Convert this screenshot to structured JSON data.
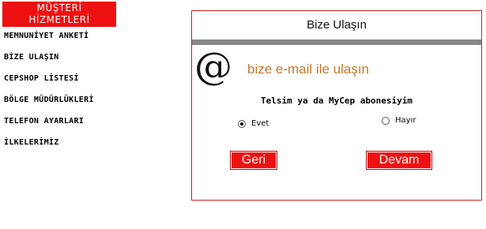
{
  "sidebar": {
    "header_line1": "MÜŞTERİ",
    "header_line2": "HİZMETLERİ",
    "items": [
      {
        "label": "MEMNUNİYET ANKETİ"
      },
      {
        "label": "BİZE ULAŞIN"
      },
      {
        "label": "CEPSHOP LİSTESİ"
      },
      {
        "label": "BÖLGE MÜDÜRLÜKLERİ"
      },
      {
        "label": "TELEFON AYARLARI"
      },
      {
        "label": "İLKELERİMİZ"
      }
    ],
    "header_color": "#ee1111"
  },
  "panel": {
    "title": "Bize Ulaşın",
    "icon": "at-sign-icon",
    "email_heading": "bize e-mail ile ulaşın",
    "question": "Telsim ya da MyCep abonesiyim",
    "options": [
      {
        "label": "Evet",
        "selected": true
      },
      {
        "label": "Hayır",
        "selected": false
      }
    ],
    "back_label": "Geri",
    "next_label": "Devam",
    "border_color": "#cc2222",
    "accent_color": "#c4782a"
  }
}
